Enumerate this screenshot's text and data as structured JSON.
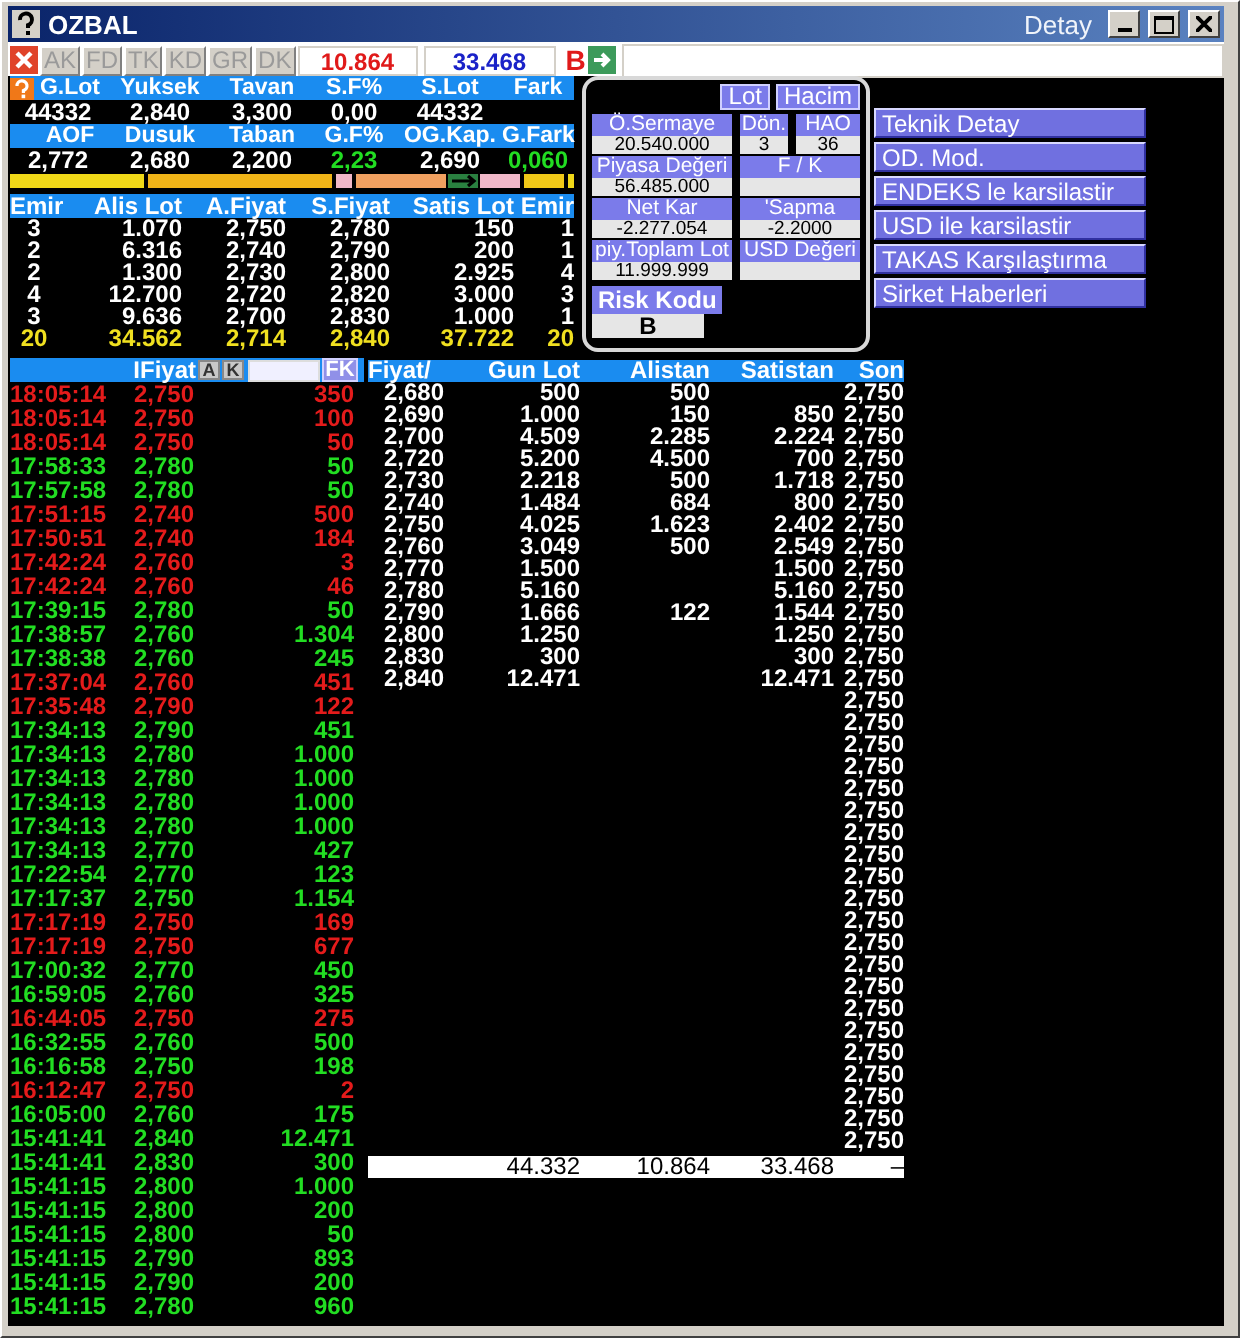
{
  "window": {
    "title": "OZBAL",
    "detail_label": "Detay"
  },
  "toolbar": {
    "buttons": [
      {
        "label": "AK",
        "disabled": true
      },
      {
        "label": "FD",
        "disabled": true
      },
      {
        "label": "TK",
        "disabled": true
      },
      {
        "label": "KD",
        "disabled": true
      },
      {
        "label": "GR",
        "disabled": true
      },
      {
        "label": "DK",
        "disabled": true
      }
    ],
    "bid_volume": "10.864",
    "ask_volume": "33.468",
    "flag": "B"
  },
  "quote": {
    "rows": [
      [
        {
          "label": "G.Lot",
          "value": "44332"
        },
        {
          "label": "Yuksek",
          "value": "2,840"
        },
        {
          "label": "Tavan",
          "value": "3,300"
        },
        {
          "label": "S.F%",
          "value": "0,00"
        },
        {
          "label": "S.Lot",
          "value": "44332"
        },
        {
          "label": "Fark"
        }
      ],
      [
        {
          "label": "AOF",
          "value": "2,772"
        },
        {
          "label": "Dusuk",
          "value": "2,680"
        },
        {
          "label": "Taban",
          "value": "2,200"
        },
        {
          "label": "G.F%",
          "value": "2,23",
          "color": "#22dd22"
        },
        {
          "label": "OG.Kap.",
          "value": "2,690"
        },
        {
          "label": "G.Fark",
          "value": "0,060",
          "color": "#22dd22"
        }
      ]
    ]
  },
  "order_book": {
    "columns": [
      "Emir",
      "Alis Lot",
      "A.Fiyat",
      "S.Fiyat",
      "Satis Lot",
      "Emir"
    ],
    "rows": [
      [
        "3",
        "1.070",
        "2,750",
        "2,780",
        "150",
        "1"
      ],
      [
        "2",
        "6.316",
        "2,740",
        "2,790",
        "200",
        "1"
      ],
      [
        "2",
        "1.300",
        "2,730",
        "2,800",
        "2.925",
        "4"
      ],
      [
        "4",
        "12.700",
        "2,720",
        "2,820",
        "3.000",
        "3"
      ],
      [
        "3",
        "9.636",
        "2,700",
        "2,830",
        "1.000",
        "1"
      ]
    ],
    "totals": [
      "20",
      "34.562",
      "2,714",
      "2,840",
      "37.722",
      "20"
    ]
  },
  "company_info": {
    "buttons": [
      "Lot",
      "Hacim"
    ],
    "rows": [
      [
        {
          "label": "Ö.Sermaye",
          "value": "20.540.000"
        },
        {
          "label": "Dön.",
          "value": "3"
        },
        {
          "label": "HAO",
          "value": "36"
        }
      ],
      [
        {
          "label": "Piyasa Değeri",
          "value": "56.485.000"
        },
        {
          "label": "F / K"
        }
      ],
      [
        {
          "label": "Net Kar",
          "value": "-2.277.054"
        },
        {
          "label": "'Sapma",
          "value": "-2.2000"
        }
      ],
      [
        {
          "label": "piy.Toplam Lot",
          "value": "11.999.999"
        },
        {
          "label": "USD Değeri"
        }
      ]
    ],
    "risk": {
      "label": "Risk Kodu",
      "value": "B"
    }
  },
  "menu": [
    "Teknik Detay",
    "OD. Mod.",
    "ENDEKS le karsilastir",
    "USD ile karsilastir",
    "TAKAS Karşılaştırma",
    "Sirket Haberleri"
  ],
  "trades": {
    "header": "IFiyat",
    "sort_buttons": [
      "A",
      "K"
    ],
    "filter_button": "FK",
    "rows": [
      {
        "time": "18:05:14",
        "price": "2,750",
        "lot": "350",
        "color": "#e41b1b"
      },
      {
        "time": "18:05:14",
        "price": "2,750",
        "lot": "100",
        "color": "#e41b1b"
      },
      {
        "time": "18:05:14",
        "price": "2,750",
        "lot": "50",
        "color": "#e41b1b"
      },
      {
        "time": "17:58:33",
        "price": "2,780",
        "lot": "50",
        "color": "#22dd22"
      },
      {
        "time": "17:57:58",
        "price": "2,780",
        "lot": "50",
        "color": "#22dd22"
      },
      {
        "time": "17:51:15",
        "price": "2,740",
        "lot": "500",
        "color": "#e41b1b"
      },
      {
        "time": "17:50:51",
        "price": "2,740",
        "lot": "184",
        "color": "#e41b1b"
      },
      {
        "time": "17:42:24",
        "price": "2,760",
        "lot": "3",
        "color": "#e41b1b"
      },
      {
        "time": "17:42:24",
        "price": "2,760",
        "lot": "46",
        "color": "#e41b1b"
      },
      {
        "time": "17:39:15",
        "price": "2,780",
        "lot": "50",
        "color": "#22dd22"
      },
      {
        "time": "17:38:57",
        "price": "2,760",
        "lot": "1.304",
        "color": "#22dd22"
      },
      {
        "time": "17:38:38",
        "price": "2,760",
        "lot": "245",
        "color": "#22dd22"
      },
      {
        "time": "17:37:04",
        "price": "2,760",
        "lot": "451",
        "color": "#e41b1b"
      },
      {
        "time": "17:35:48",
        "price": "2,790",
        "lot": "122",
        "color": "#e41b1b"
      },
      {
        "time": "17:34:13",
        "price": "2,790",
        "lot": "451",
        "color": "#22dd22"
      },
      {
        "time": "17:34:13",
        "price": "2,780",
        "lot": "1.000",
        "color": "#22dd22"
      },
      {
        "time": "17:34:13",
        "price": "2,780",
        "lot": "1.000",
        "color": "#22dd22"
      },
      {
        "time": "17:34:13",
        "price": "2,780",
        "lot": "1.000",
        "color": "#22dd22"
      },
      {
        "time": "17:34:13",
        "price": "2,780",
        "lot": "1.000",
        "color": "#22dd22"
      },
      {
        "time": "17:34:13",
        "price": "2,770",
        "lot": "427",
        "color": "#22dd22"
      },
      {
        "time": "17:22:54",
        "price": "2,770",
        "lot": "123",
        "color": "#22dd22"
      },
      {
        "time": "17:17:37",
        "price": "2,750",
        "lot": "1.154",
        "color": "#22dd22"
      },
      {
        "time": "17:17:19",
        "price": "2,750",
        "lot": "169",
        "color": "#e41b1b"
      },
      {
        "time": "17:17:19",
        "price": "2,750",
        "lot": "677",
        "color": "#e41b1b"
      },
      {
        "time": "17:00:32",
        "price": "2,770",
        "lot": "450",
        "color": "#22dd22"
      },
      {
        "time": "16:59:05",
        "price": "2,760",
        "lot": "325",
        "color": "#22dd22"
      },
      {
        "time": "16:44:05",
        "price": "2,750",
        "lot": "275",
        "color": "#e41b1b"
      },
      {
        "time": "16:32:55",
        "price": "2,760",
        "lot": "500",
        "color": "#22dd22"
      },
      {
        "time": "16:16:58",
        "price": "2,750",
        "lot": "198",
        "color": "#22dd22"
      },
      {
        "time": "16:12:47",
        "price": "2,750",
        "lot": "2",
        "color": "#e41b1b"
      },
      {
        "time": "16:05:00",
        "price": "2,760",
        "lot": "175",
        "color": "#22dd22"
      },
      {
        "time": "15:41:41",
        "price": "2,840",
        "lot": "12.471",
        "color": "#22dd22"
      },
      {
        "time": "15:41:41",
        "price": "2,830",
        "lot": "300",
        "color": "#22dd22"
      },
      {
        "time": "15:41:15",
        "price": "2,800",
        "lot": "1.000",
        "color": "#22dd22"
      },
      {
        "time": "15:41:15",
        "price": "2,800",
        "lot": "200",
        "color": "#22dd22"
      },
      {
        "time": "15:41:15",
        "price": "2,800",
        "lot": "50",
        "color": "#22dd22"
      },
      {
        "time": "15:41:15",
        "price": "2,790",
        "lot": "893",
        "color": "#22dd22"
      },
      {
        "time": "15:41:15",
        "price": "2,790",
        "lot": "200",
        "color": "#22dd22"
      },
      {
        "time": "15:41:15",
        "price": "2,780",
        "lot": "960",
        "color": "#22dd22"
      }
    ]
  },
  "price_table": {
    "columns": [
      "Fiyat/",
      "Gun Lot",
      "Alistan",
      "Satistan",
      "Son"
    ],
    "rows": [
      {
        "price": "2,680",
        "volume": "500",
        "bid": "500",
        "last": "2,750"
      },
      {
        "price": "2,690",
        "volume": "1.000",
        "bid": "150",
        "ask": "850",
        "last": "2,750"
      },
      {
        "price": "2,700",
        "volume": "4.509",
        "bid": "2.285",
        "ask": "2.224",
        "last": "2,750"
      },
      {
        "price": "2,720",
        "volume": "5.200",
        "bid": "4.500",
        "ask": "700",
        "last": "2,750"
      },
      {
        "price": "2,730",
        "volume": "2.218",
        "bid": "500",
        "ask": "1.718",
        "last": "2,750"
      },
      {
        "price": "2,740",
        "volume": "1.484",
        "bid": "684",
        "ask": "800",
        "last": "2,750"
      },
      {
        "price": "2,750",
        "volume": "4.025",
        "bid": "1.623",
        "ask": "2.402",
        "last": "2,750"
      },
      {
        "price": "2,760",
        "volume": "3.049",
        "bid": "500",
        "ask": "2.549",
        "last": "2,750"
      },
      {
        "price": "2,770",
        "volume": "1.500",
        "ask": "1.500",
        "last": "2,750"
      },
      {
        "price": "2,780",
        "volume": "5.160",
        "ask": "5.160",
        "last": "2,750"
      },
      {
        "price": "2,790",
        "volume": "1.666",
        "bid": "122",
        "ask": "1.544",
        "last": "2,750"
      },
      {
        "price": "2,800",
        "volume": "1.250",
        "ask": "1.250",
        "last": "2,750"
      },
      {
        "price": "2,830",
        "volume": "300",
        "ask": "300",
        "last": "2,750"
      },
      {
        "price": "2,840",
        "volume": "12.471",
        "ask": "12.471",
        "last": "2,750"
      },
      {
        "last": "2,750"
      },
      {
        "last": "2,750"
      },
      {
        "last": "2,750"
      },
      {
        "last": "2,750"
      },
      {
        "last": "2,750"
      },
      {
        "last": "2,750"
      },
      {
        "last": "2,750"
      },
      {
        "last": "2,750"
      },
      {
        "last": "2,750"
      },
      {
        "last": "2,750"
      },
      {
        "last": "2,750"
      },
      {
        "last": "2,750"
      },
      {
        "last": "2,750"
      },
      {
        "last": "2,750"
      },
      {
        "last": "2,750"
      },
      {
        "last": "2,750"
      },
      {
        "last": "2,750"
      },
      {
        "last": "2,750"
      },
      {
        "last": "2,750"
      },
      {
        "last": "2,750"
      },
      {
        "last": "2,750"
      }
    ],
    "totals": {
      "volume": "44.332",
      "bid": "10.864",
      "ask": "33.468",
      "last": "–"
    }
  }
}
